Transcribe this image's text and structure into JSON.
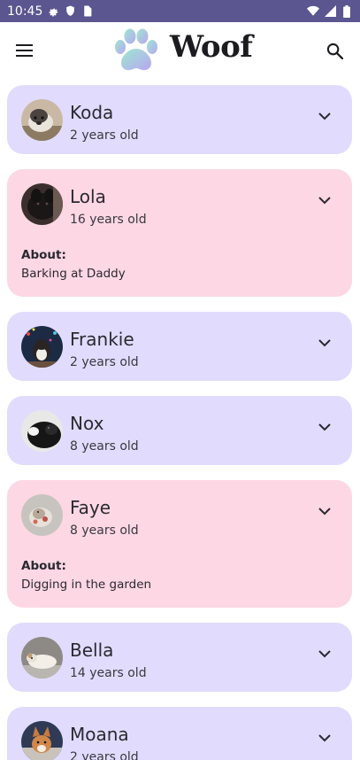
{
  "status_bar": {
    "time": "10:45",
    "left_icons": [
      "gear-icon",
      "shield-icon",
      "sim-card-icon"
    ],
    "right_icons": [
      "wifi-icon",
      "signal-icon",
      "battery-icon"
    ]
  },
  "app_bar": {
    "title": "Woof",
    "logo_icon": "paw-icon",
    "menu_icon": "hamburger-menu-icon",
    "search_icon": "search-icon"
  },
  "colors": {
    "status_bar": "#5b5590",
    "card_collapsed": "#e1dcfd",
    "card_expanded": "#fdd7e4"
  },
  "dogs": [
    {
      "name": "Koda",
      "age": "2 years old",
      "expanded": false
    },
    {
      "name": "Lola",
      "age": "16 years old",
      "expanded": true,
      "about_label": "About:",
      "about": "Barking at Daddy"
    },
    {
      "name": "Frankie",
      "age": "2 years old",
      "expanded": false
    },
    {
      "name": "Nox",
      "age": "8 years old",
      "expanded": false
    },
    {
      "name": "Faye",
      "age": "8 years old",
      "expanded": true,
      "about_label": "About:",
      "about": "Digging in the garden"
    },
    {
      "name": "Bella",
      "age": "14 years old",
      "expanded": false
    },
    {
      "name": "Moana",
      "age": "2 years old",
      "expanded": false
    }
  ]
}
